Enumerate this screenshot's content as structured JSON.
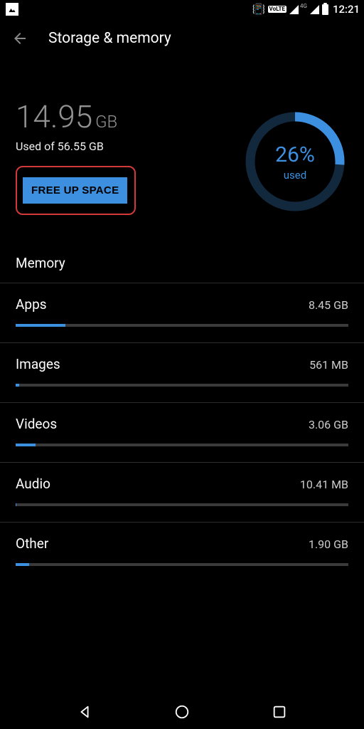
{
  "status": {
    "volte": "VoLTE",
    "net_label": "4G",
    "time": "12:21"
  },
  "header": {
    "title": "Storage & memory"
  },
  "storage": {
    "used_value": "14.95",
    "used_unit": "GB",
    "used_subtext": "Used of 56.55 GB",
    "free_button": "FREE UP SPACE",
    "ring_percent": "26%",
    "ring_label": "used",
    "ring_value": 26
  },
  "section": {
    "memory_label": "Memory"
  },
  "rows": [
    {
      "name": "Apps",
      "value": "8.45 GB",
      "pct": 15
    },
    {
      "name": "Images",
      "value": "561 MB",
      "pct": 1
    },
    {
      "name": "Videos",
      "value": "3.06 GB",
      "pct": 6
    },
    {
      "name": "Audio",
      "value": "10.41 MB",
      "pct": 0.2
    },
    {
      "name": "Other",
      "value": "1.90 GB",
      "pct": 4
    }
  ]
}
